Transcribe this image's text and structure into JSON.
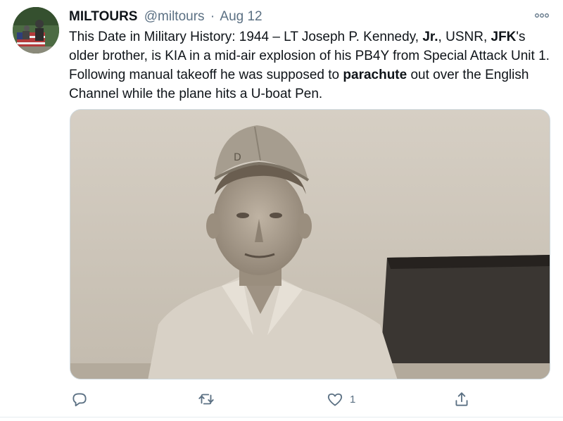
{
  "tweet": {
    "display_name": "MILTOURS",
    "handle": "@miltours",
    "separator": "·",
    "date": "Aug 12",
    "text": {
      "p1": "This Date in Military History: 1944 – LT Joseph P. Kennedy, ",
      "b1": "Jr.",
      "p2": ", USNR, ",
      "b2": "JFK",
      "p3": "'s older brother, is KIA in a mid-air explosion of his PB4Y from Special Attack Unit 1. Following manual takeoff he was supposed to ",
      "b3": "parachute",
      "p4": " out over the English Channel while the plane hits a U-boat Pen."
    }
  },
  "actions": {
    "reply_icon": "reply-icon",
    "retweet_icon": "retweet-icon",
    "like_icon": "heart-icon",
    "like_count": "1",
    "share_icon": "share-icon"
  },
  "colors": {
    "text_primary": "#0f1419",
    "text_secondary": "#5b7083",
    "icon": "#5b7083",
    "border": "#cfd9de"
  }
}
